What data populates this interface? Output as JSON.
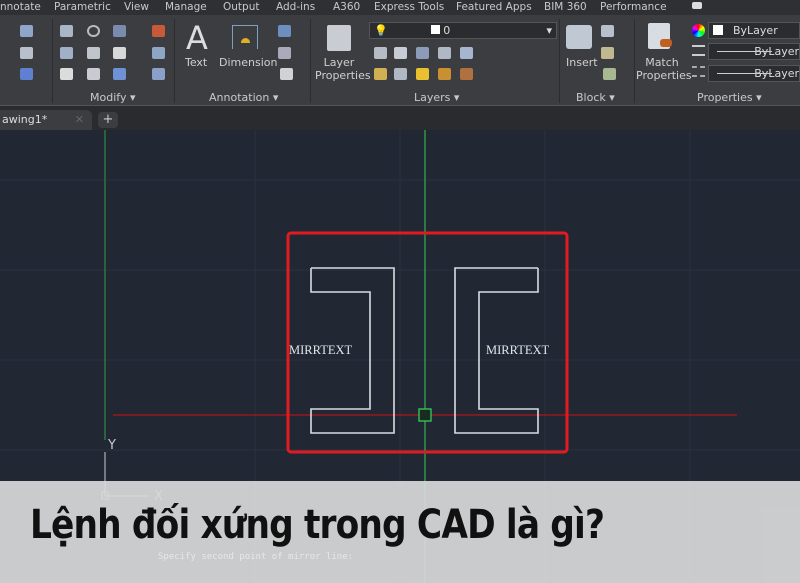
{
  "menu_tabs": [
    "nnotate",
    "Parametric",
    "View",
    "Manage",
    "Output",
    "Add-ins",
    "A360",
    "Express Tools",
    "Featured Apps",
    "BIM 360",
    "Performance"
  ],
  "ribbon": {
    "panels": {
      "modify": "Modify ▾",
      "annotation": "Annotation ▾",
      "layers": "Layers ▾",
      "block": "Block ▾",
      "properties": "Properties ▾"
    },
    "text_label": "Text",
    "dimension_label": "Dimension",
    "layer_properties_label": "Layer Properties",
    "insert_label": "Insert",
    "match_properties_label": "Match Properties",
    "layer_value": "0",
    "color_value": "ByLayer",
    "linetype_value": "ByLayer",
    "lineweight_value": "ByLayer"
  },
  "tabs": {
    "drawing": "awing1*",
    "close": "✕",
    "new": "+"
  },
  "drawing": {
    "left_text": "MIRRTEXT",
    "right_text": "MIRRTEXT",
    "ucs_x": "X",
    "ucs_y": "Y"
  },
  "command_line": "Specify second point of mirror line:",
  "caption": "Lệnh đối xứng trong CAD là gì?",
  "colors": {
    "canvas": "#212733",
    "ribbon": "#3c3d40",
    "selection": "#e11b22",
    "mirror_line": "#2fa84f",
    "caption_band": "#d7d8d9"
  }
}
